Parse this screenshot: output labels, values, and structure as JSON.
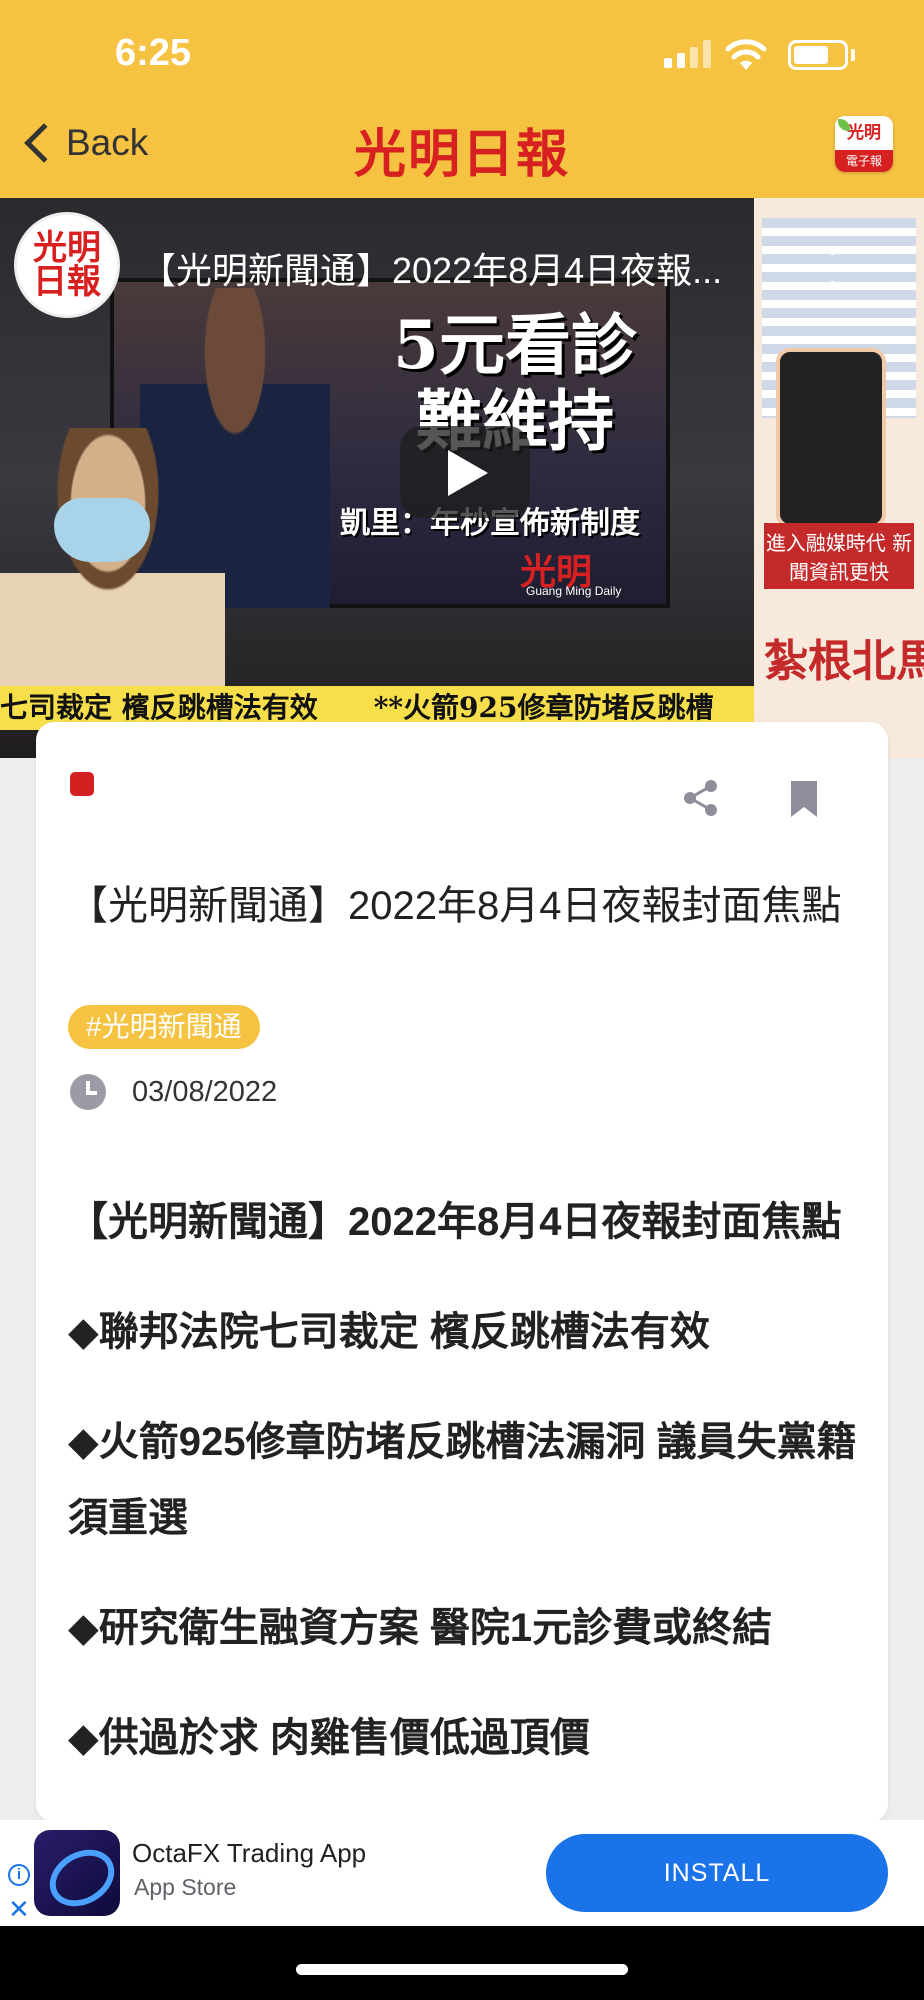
{
  "status_bar": {
    "time": "6:25"
  },
  "header": {
    "back_label": "Back",
    "app_title": "光明日報",
    "epaper_label_top": "光明",
    "epaper_label_bottom": "電子報"
  },
  "video": {
    "channel_avatar_text": "光明日報",
    "title": "【光明新聞通】2022年8月4日夜報...",
    "headline_big": "5元看診難維持",
    "headline_sub": "凱里：年杪宣佈新制度",
    "logo_text": "光明",
    "logo_sub": "Guang Ming Daily",
    "ticker": "七司裁定 檳反跳槽法有效　　**火箭925修章防堵反跳槽",
    "side_promo_1": "進入融媒時代 新聞資訊更快",
    "side_promo_2": "紮根北馬 面向全國"
  },
  "article": {
    "title": "【光明新聞通】2022年8月4日夜報封面焦點",
    "tag": "#光明新聞通",
    "date": "03/08/2022",
    "body": [
      "【光明新聞通】2022年8月4日夜報封面焦點",
      "◆聯邦法院七司裁定 檳反跳槽法有效",
      "◆火箭925修章防堵反跳槽法漏洞 議員失黨籍須重選",
      "◆研究衛生融資方案 醫院1元診費或終結",
      "◆供過於求 肉雞售價低過頂價"
    ]
  },
  "ad": {
    "app_name": "OctaFX Trading App",
    "store": "App Store",
    "cta": "INSTALL"
  },
  "colors": {
    "header_bg": "#f5c242",
    "brand_red": "#d72020",
    "tag_bg": "#f5c242",
    "install_blue": "#1a73e8"
  }
}
